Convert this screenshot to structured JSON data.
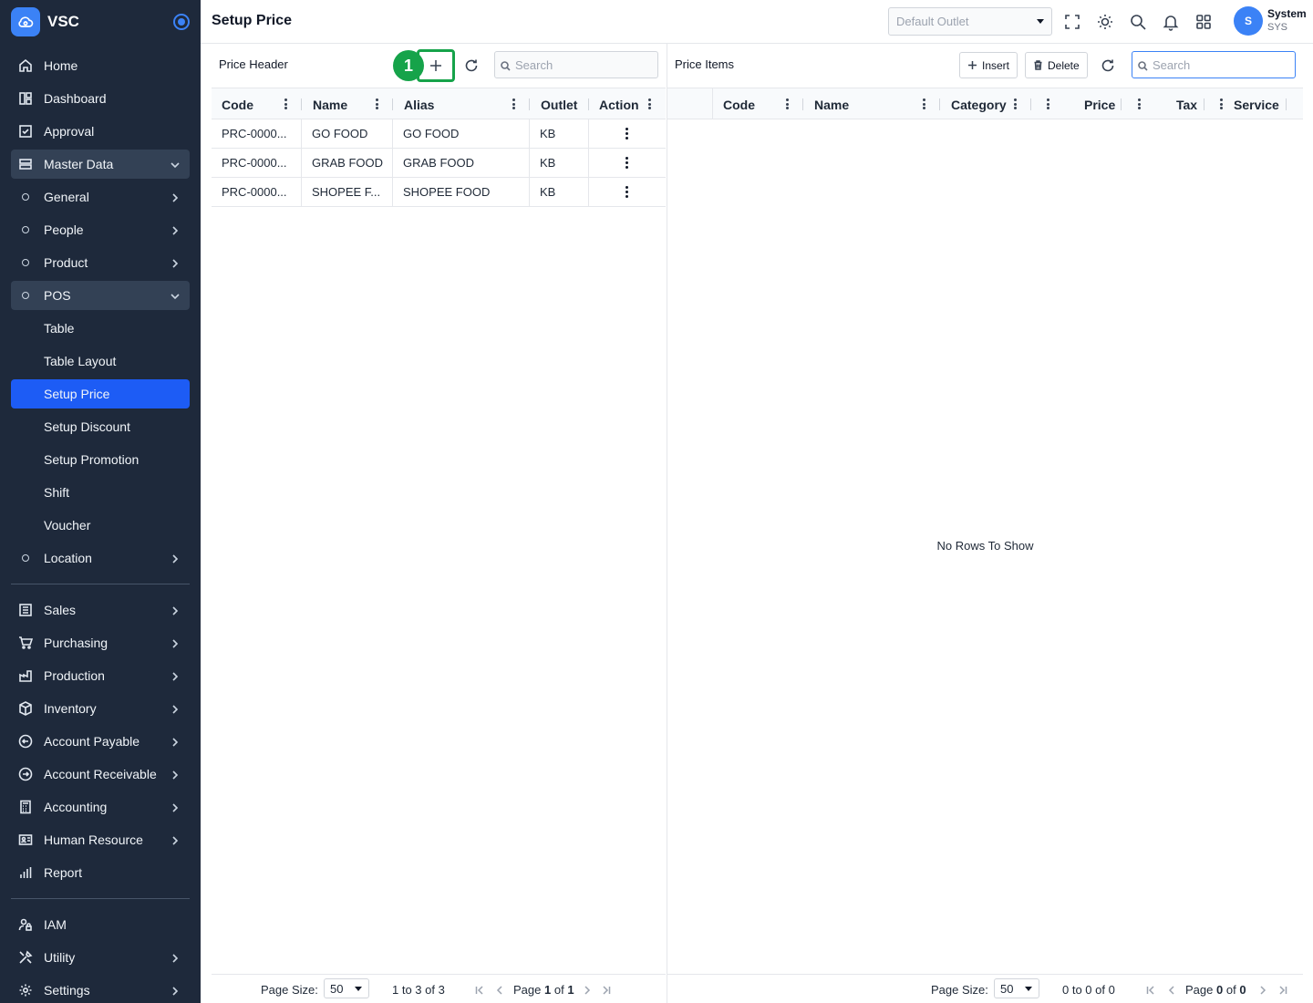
{
  "app": {
    "name": "VSC"
  },
  "sidebar": {
    "items": [
      {
        "label": "Home",
        "icon": "home-icon"
      },
      {
        "label": "Dashboard",
        "icon": "dashboard-icon"
      },
      {
        "label": "Approval",
        "icon": "approval-icon"
      },
      {
        "label": "Master Data",
        "icon": "database-icon",
        "expanded": true
      },
      {
        "label": "General"
      },
      {
        "label": "People"
      },
      {
        "label": "Product"
      },
      {
        "label": "POS",
        "expanded": true
      },
      {
        "label": "Table"
      },
      {
        "label": "Table Layout"
      },
      {
        "label": "Setup Price",
        "active": true
      },
      {
        "label": "Setup Discount"
      },
      {
        "label": "Setup Promotion"
      },
      {
        "label": "Shift"
      },
      {
        "label": "Voucher"
      },
      {
        "label": "Location"
      },
      {
        "label": "Sales",
        "icon": "sales-icon"
      },
      {
        "label": "Purchasing",
        "icon": "cart-icon"
      },
      {
        "label": "Production",
        "icon": "factory-icon"
      },
      {
        "label": "Inventory",
        "icon": "box-icon"
      },
      {
        "label": "Account Payable",
        "icon": "arrow-left-circle-icon"
      },
      {
        "label": "Account Receivable",
        "icon": "arrow-right-circle-icon"
      },
      {
        "label": "Accounting",
        "icon": "calculator-icon"
      },
      {
        "label": "Human Resource",
        "icon": "id-card-icon"
      },
      {
        "label": "Report",
        "icon": "bar-chart-icon"
      },
      {
        "label": "IAM",
        "icon": "user-lock-icon"
      },
      {
        "label": "Utility",
        "icon": "tools-icon"
      },
      {
        "label": "Settings",
        "icon": "gear-icon"
      }
    ]
  },
  "header": {
    "title": "Setup Price",
    "outlet_placeholder": "Default Outlet",
    "user": {
      "initial": "S",
      "name": "System",
      "role": "SYS"
    }
  },
  "price_header": {
    "title": "Price Header",
    "badge": "1",
    "search_placeholder": "Search",
    "columns": [
      "Code",
      "Name",
      "Alias",
      "Outlet",
      "Action"
    ],
    "rows": [
      {
        "code": "PRC-0000...",
        "name": "GO FOOD",
        "alias": "GO FOOD",
        "outlet": "KB"
      },
      {
        "code": "PRC-0000...",
        "name": "GRAB FOOD",
        "alias": "GRAB FOOD",
        "outlet": "KB"
      },
      {
        "code": "PRC-0000...",
        "name": "SHOPEE F...",
        "alias": "SHOPEE FOOD",
        "outlet": "KB"
      }
    ],
    "footer": {
      "page_size_label": "Page Size:",
      "page_size": "50",
      "range": "1 to 3 of 3",
      "page_label": "Page",
      "page": "1",
      "of_label": "of",
      "pages": "1"
    }
  },
  "price_items": {
    "title": "Price Items",
    "insert_label": "Insert",
    "delete_label": "Delete",
    "search_placeholder": "Search",
    "columns": [
      "Code",
      "Name",
      "Category",
      "Price",
      "Tax",
      "Service"
    ],
    "empty_message": "No Rows To Show",
    "footer": {
      "page_size_label": "Page Size:",
      "page_size": "50",
      "range": "0 to 0 of 0",
      "page_label": "Page",
      "page": "0",
      "of_label": "of",
      "pages": "0"
    }
  },
  "colors": {
    "sidebar_bg": "#1e293b",
    "active_item": "#1d5cf5",
    "highlight": "#16a34a",
    "accent": "#3b82f6"
  }
}
